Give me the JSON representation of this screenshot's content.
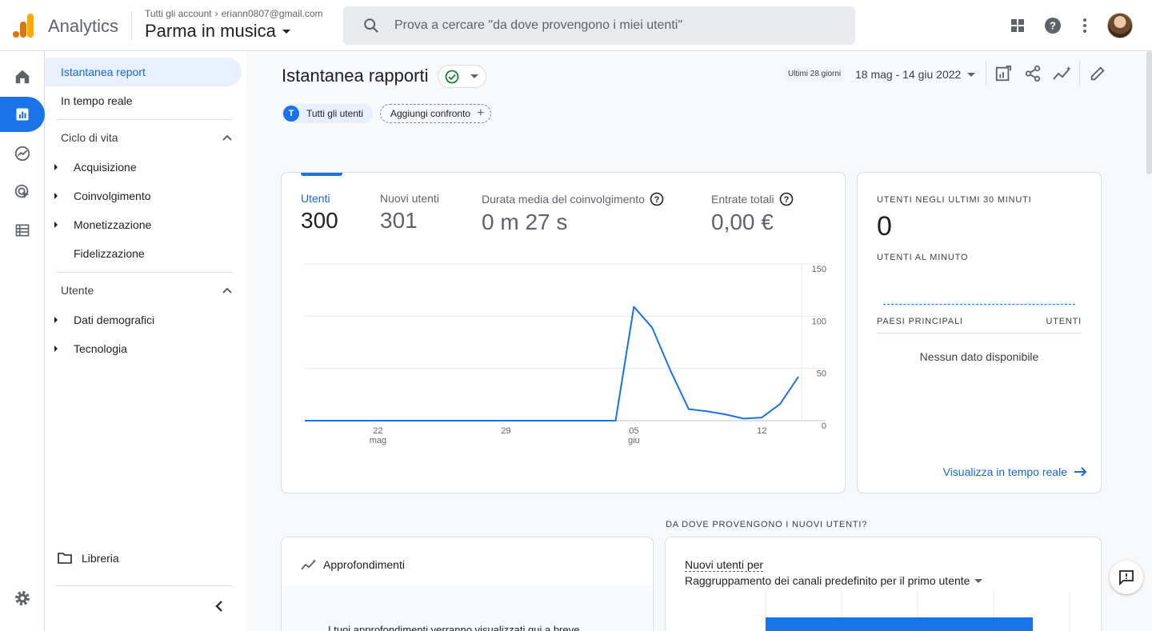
{
  "header": {
    "app_name": "Analytics",
    "account_path": "Tutti gli account",
    "account_email": "eriann0807@gmail.com",
    "property_name": "Parma in musica",
    "search_placeholder": "Prova a cercare \"da dove provengono i miei utenti\""
  },
  "sidenav": {
    "snapshot": "Istantanea report",
    "realtime": "In tempo reale",
    "lifecycle": {
      "title": "Ciclo di vita",
      "items": [
        "Acquisizione",
        "Coinvolgimento",
        "Monetizzazione",
        "Fidelizzazione"
      ]
    },
    "user": {
      "title": "Utente",
      "items": [
        "Dati demografici",
        "Tecnologia"
      ]
    },
    "library": "Libreria"
  },
  "main": {
    "title": "Istantanea rapporti",
    "date_label": "Ultimi 28 giorni",
    "date_range": "18 mag - 14 giu 2022",
    "chip_all_users_letter": "T",
    "chip_all_users": "Tutti gli utenti",
    "chip_add_compare": "Aggiungi confronto"
  },
  "kpis": [
    {
      "label": "Utenti",
      "value": "300"
    },
    {
      "label": "Nuovi utenti",
      "value": "301"
    },
    {
      "label": "Durata media del coinvolgimento",
      "value": "0 m 27 s"
    },
    {
      "label": "Entrate totali",
      "value": "0,00 €"
    }
  ],
  "chart_data": {
    "type": "line",
    "x": [
      "18 mag",
      "19 mag",
      "20 mag",
      "21 mag",
      "22 mag",
      "23 mag",
      "24 mag",
      "25 mag",
      "26 mag",
      "27 mag",
      "28 mag",
      "29 mag",
      "30 mag",
      "31 mag",
      "1 giu",
      "2 giu",
      "3 giu",
      "4 giu",
      "5 giu",
      "6 giu",
      "7 giu",
      "8 giu",
      "9 giu",
      "10 giu",
      "11 giu",
      "12 giu",
      "13 giu",
      "14 giu"
    ],
    "series": [
      {
        "values": [
          0,
          0,
          0,
          0,
          0,
          0,
          0,
          0,
          0,
          0,
          0,
          0,
          0,
          0,
          0,
          0,
          0,
          0,
          109,
          89,
          48,
          11,
          9,
          6,
          2,
          3,
          16,
          42
        ]
      }
    ],
    "x_ticks": [
      {
        "day": "22",
        "month": "mag"
      },
      {
        "day": "29",
        "month": ""
      },
      {
        "day": "05",
        "month": "giu"
      },
      {
        "day": "12",
        "month": ""
      }
    ],
    "y_ticks": [
      "150",
      "100",
      "50",
      "0"
    ],
    "ylim": [
      0,
      150
    ],
    "grid": true,
    "color": "#1a73e8"
  },
  "realtime": {
    "title": "UTENTI NEGLI ULTIMI 30 MINUTI",
    "value": "0",
    "per_minute": "UTENTI AL MINUTO",
    "col_countries": "PAESI PRINCIPALI",
    "col_users": "UTENTI",
    "empty": "Nessun dato disponibile",
    "link": "Visualizza in tempo reale"
  },
  "bottom": {
    "section_label": "DA DOVE PROVENGONO I NUOVI UTENTI?",
    "insights_title": "Approfondimenti",
    "insights_text": "I tuoi approfondimenti verranno visualizzati qui a breve",
    "new_users_title": "Nuovi utenti per",
    "new_users_dim": "Raggruppamento dei canali predefinito per il primo utente"
  },
  "colors": {
    "accent": "#1a73e8",
    "accent_dark": "#1967d2",
    "nav_active_bg": "#e8f0fe"
  }
}
